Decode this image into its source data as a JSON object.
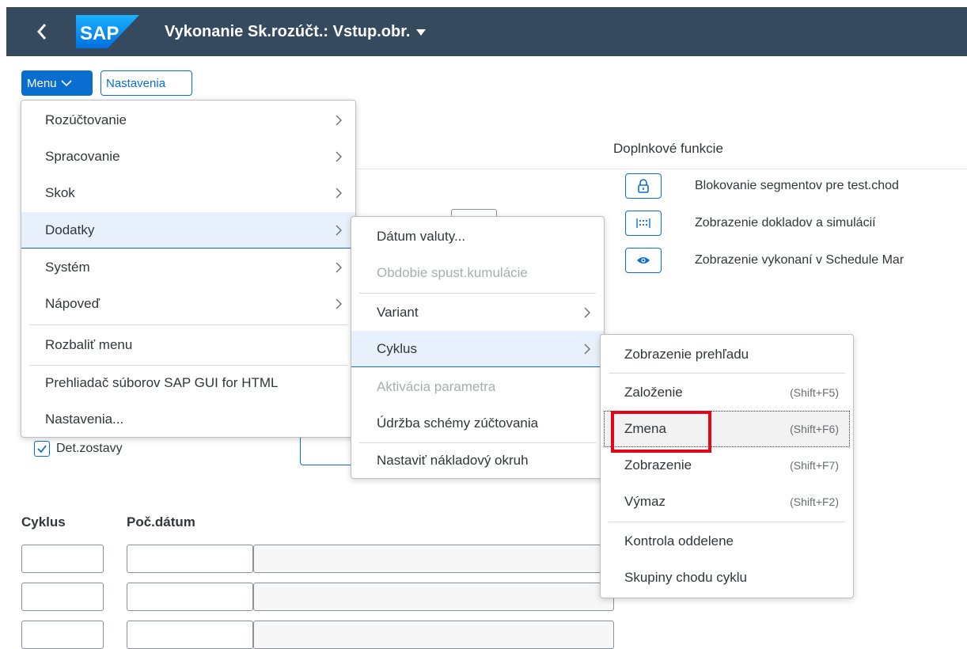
{
  "shell": {
    "title": "Vykonanie Sk.rozúčt.: Vstup.obr.",
    "logo_text": "SAP"
  },
  "toolbar": {
    "menu_label": "Menu",
    "settings_label": "Nastavenia"
  },
  "side": {
    "title": "Doplnkové funkcie",
    "functions": [
      {
        "label": "Blokovanie segmentov pre test.chod",
        "icon": "lock-icon"
      },
      {
        "label": "Zobrazenie dokladov a simulácií",
        "icon": "document-grid-icon"
      },
      {
        "label": "Zobrazenie vykonaní v Schedule Mar",
        "icon": "eye-icon"
      }
    ]
  },
  "form": {
    "checkbox_label": "Det.zostavy",
    "checkbox_checked": true,
    "col_cycle": "Cyklus",
    "col_start_date": "Poč.dátum"
  },
  "menu1": {
    "items": [
      {
        "label": "Rozúčtovanie"
      },
      {
        "label": "Spracovanie"
      },
      {
        "label": "Skok"
      },
      {
        "label": "Dodatky"
      },
      {
        "label": "Systém"
      },
      {
        "label": "Nápoveď"
      },
      {
        "label": "Rozbaliť menu"
      },
      {
        "label": "Prehliadač súborov SAP GUI for HTML"
      },
      {
        "label": "Nastavenia..."
      }
    ]
  },
  "menu2": {
    "items": [
      {
        "label": "Dátum valuty..."
      },
      {
        "label": "Obdobie spust.kumulácie"
      },
      {
        "label": "Variant"
      },
      {
        "label": "Cyklus"
      },
      {
        "label": "Aktivácia parametra"
      },
      {
        "label": "Údržba schémy zúčtovania"
      },
      {
        "label": "Nastaviť nákladový okruh"
      }
    ]
  },
  "menu3": {
    "items": [
      {
        "label": "Zobrazenie prehľadu",
        "shortcut": ""
      },
      {
        "label": "Založenie",
        "shortcut": "(Shift+F5)"
      },
      {
        "label": "Zmena",
        "shortcut": "(Shift+F6)"
      },
      {
        "label": "Zobrazenie",
        "shortcut": "(Shift+F7)"
      },
      {
        "label": "Výmaz",
        "shortcut": "(Shift+F2)"
      },
      {
        "label": "Kontrola oddelene",
        "shortcut": ""
      },
      {
        "label": "Skupiny chodu cyklu",
        "shortcut": ""
      }
    ]
  },
  "colors": {
    "shell": "#354a5f",
    "accent": "#0a6ed1",
    "highlight": "#e3061b"
  }
}
